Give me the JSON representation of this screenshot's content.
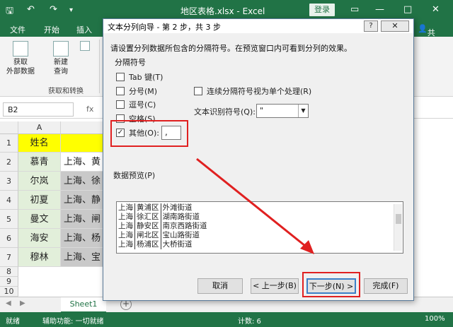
{
  "window": {
    "qa_icons": [
      "save-icon",
      "undo-icon",
      "redo-icon",
      "customize-icon"
    ],
    "title": "地区表格.xlsx  -  Excel",
    "login": "登录",
    "minimize": "—",
    "restore": "□",
    "close": "✕"
  },
  "ribbon": {
    "tabs": [
      "文件",
      "开始",
      "插入"
    ],
    "share": "共享",
    "get_data_label": "获取\n外部数据",
    "new_query_label": "新建\n查询",
    "group_label": "获取和转换"
  },
  "formula_bar": {
    "name_box": "B2",
    "fx": "fx"
  },
  "grid": {
    "col_a": "A",
    "rows": [
      "1",
      "2",
      "3",
      "4",
      "5",
      "6",
      "7",
      "8",
      "9",
      "10"
    ],
    "header_name": "姓名",
    "names": [
      "慕青",
      "尔岚",
      "初夏",
      "曼文",
      "海安",
      "穆林"
    ],
    "addresses": [
      "上海、黄",
      "上海、徐",
      "上海、静",
      "上海、闸",
      "上海、杨",
      "上海、宝"
    ]
  },
  "sheets": {
    "tab": "Sheet1",
    "add": "+"
  },
  "status": {
    "ready": "就绪",
    "accessibility": "辅助功能: 一切就绪",
    "count": "计数: 6",
    "zoom": "100%"
  },
  "dialog": {
    "title": "文本分列向导 - 第 2 步，共 3 步",
    "help": "?",
    "close": "✕",
    "instruction": "请设置分列数据所包含的分隔符号。在预览窗口内可看到分列的效果。",
    "delimiters_label": "分隔符号",
    "tab_label": "Tab 键(T)",
    "semicolon_label": "分号(M)",
    "comma_label": "逗号(C)",
    "space_label": "空格(S)",
    "other_label": "其他(O):",
    "other_value": ",",
    "consecutive_label": "连续分隔符号视为单个处理(R)",
    "qualifier_label": "文本识别符号(Q):",
    "qualifier_value": "\"",
    "preview_label": "数据预览(P)",
    "preview_rows": [
      [
        "上海",
        "黄浦区",
        "外滩街道"
      ],
      [
        "上海",
        "徐汇区",
        "湖南路街道"
      ],
      [
        "上海",
        "静安区",
        "南京西路街道"
      ],
      [
        "上海",
        "闸北区",
        "宝山路街道"
      ],
      [
        "上海",
        "杨浦区",
        "大桥街道"
      ]
    ],
    "btn_cancel": "取消",
    "btn_back": "< 上一步(B)",
    "btn_next": "下一步(N) >",
    "btn_finish": "完成(F)"
  },
  "colors": {
    "excel_green": "#217346",
    "header_yellow": "#ffff00",
    "name_cell_green": "#e2efda",
    "selection_gray": "#c9c9c9",
    "annotation_red": "#e02020"
  }
}
